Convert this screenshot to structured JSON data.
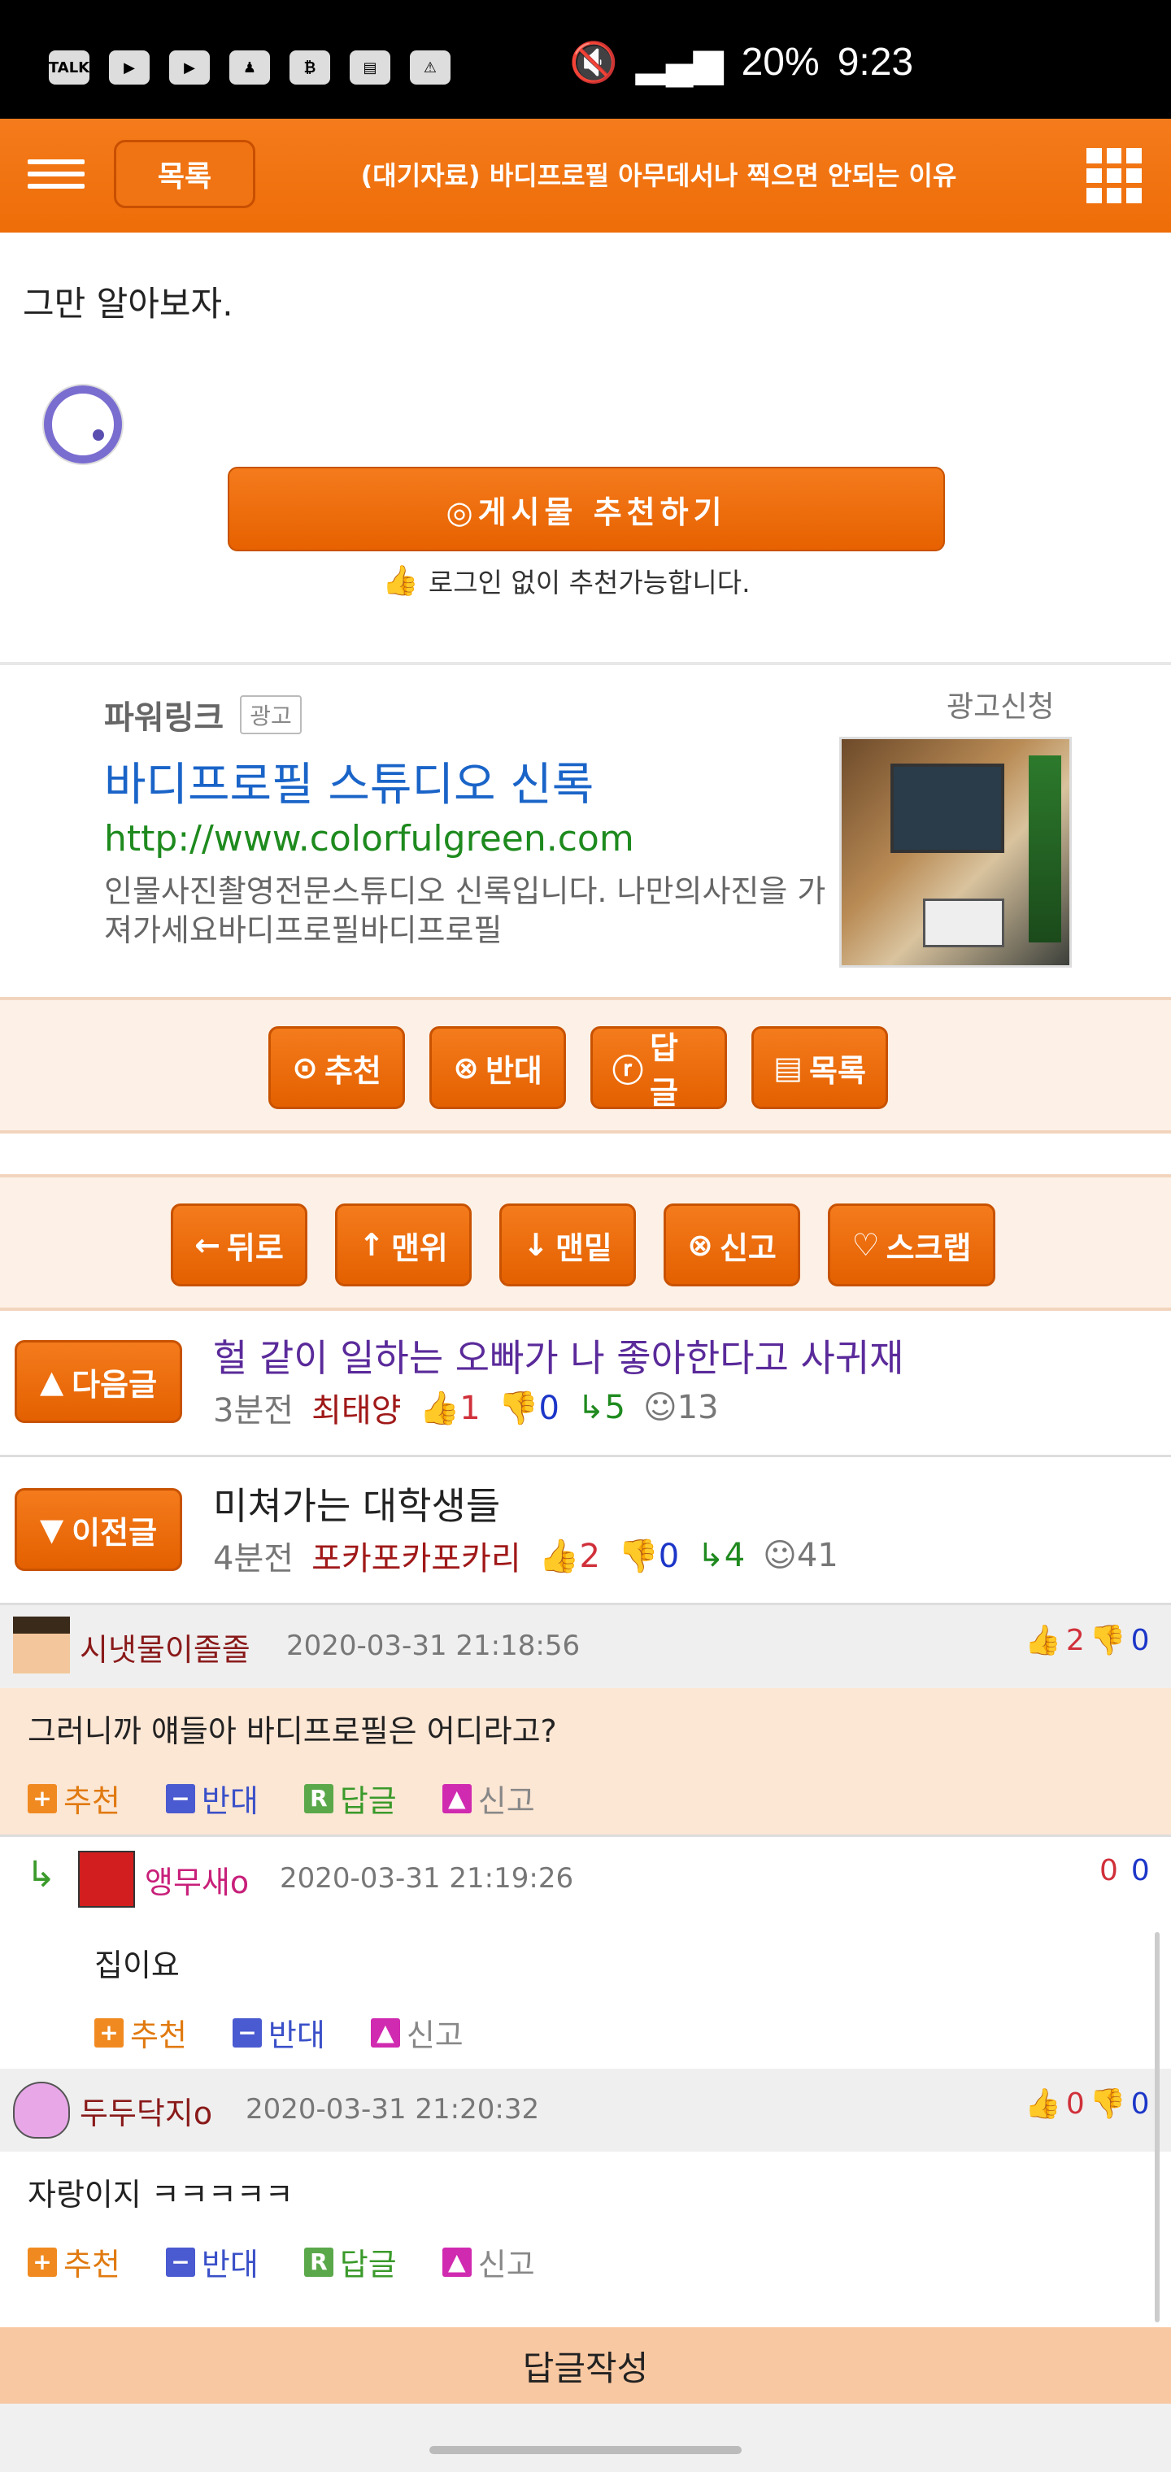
{
  "status_bar": {
    "icons": [
      "talk-icon",
      "youtube-icon",
      "youtube-icon",
      "notification-icon",
      "bitcoin-icon",
      "app-icon",
      "warning-icon"
    ],
    "battery": "20%",
    "time": "9:23"
  },
  "topbar": {
    "list_label": "목록",
    "title": "(대기자료) 바디프로필 아무데서나 찍으면 안되는 이유"
  },
  "post": {
    "body_text": "그만 알아보자.",
    "recommend_button": "◎게시물 추천하기",
    "recommend_note": "로그인 없이 추천가능합니다."
  },
  "ad": {
    "label": "파워링크",
    "badge": "광고",
    "request": "광고신청",
    "title": "바디프로필 스튜디오 신록",
    "url": "http://www.colorfulgreen.com",
    "description": "인물사진촬영전문스튜디오 신록입니다. 나만의사진을 가져가세요바디프로필바디프로필"
  },
  "actions": {
    "recommend": "추천",
    "oppose": "반대",
    "reply": "답글",
    "list": "목록"
  },
  "nav_actions": {
    "back": "뒤로",
    "top": "맨위",
    "bottom": "맨밑",
    "report": "신고",
    "scrap": "스크랩"
  },
  "next_post": {
    "button": "다음글",
    "title": "헐 같이 일하는 오빠가 나 좋아한다고 사귀재",
    "time": "3분전",
    "author": "최태양",
    "up": "1",
    "down": "0",
    "replies": "5",
    "views": "13"
  },
  "prev_post": {
    "button": "이전글",
    "title": "미쳐가는 대학생들",
    "time": "4분전",
    "author": "포카포카포카리",
    "up": "2",
    "down": "0",
    "replies": "4",
    "views": "41"
  },
  "comments": [
    {
      "author": "시냇물이졸졸",
      "date": "2020-03-31 21:18:56",
      "up": "2",
      "down": "0",
      "text": "그러니까 얘들아 바디프로필은 어디라고?",
      "actions": [
        "추천",
        "반대",
        "답글",
        "신고"
      ]
    },
    {
      "author": "앵무새o",
      "date": "2020-03-31 21:19:26",
      "up": "0",
      "down": "0",
      "text": "집이요",
      "actions": [
        "추천",
        "반대",
        "신고"
      ]
    },
    {
      "author": "두두닥지o",
      "date": "2020-03-31 21:20:32",
      "up": "0",
      "down": "0",
      "text": "자랑이지 ㅋㅋㅋㅋㅋ",
      "actions": [
        "추천",
        "반대",
        "답글",
        "신고"
      ]
    }
  ],
  "reply_bar": "답글작성",
  "colors": {
    "accent": "#ee6d08",
    "panel": "#fdf1e7",
    "reply_bar": "#f8c8a2"
  }
}
